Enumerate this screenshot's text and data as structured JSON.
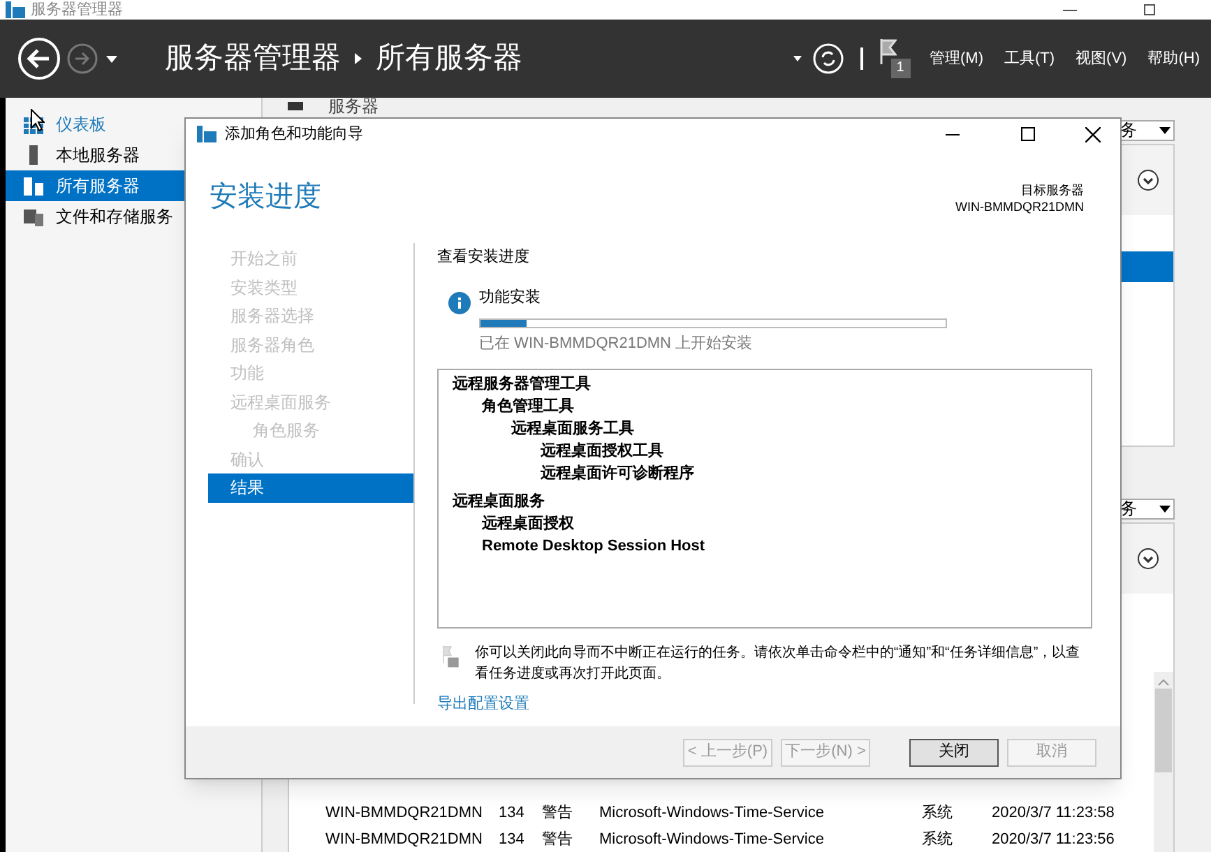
{
  "window": {
    "title": "服务器管理器"
  },
  "header": {
    "breadcrumb": [
      "服务器管理器",
      "所有服务器"
    ],
    "notification_count": "1",
    "menu": [
      "管理(M)",
      "工具(T)",
      "视图(V)",
      "帮助(H)"
    ]
  },
  "sidebar": {
    "items": [
      {
        "label": "仪表板",
        "selected": false,
        "kind": "dashboard"
      },
      {
        "label": "本地服务器",
        "selected": false,
        "kind": "server"
      },
      {
        "label": "所有服务器",
        "selected": true,
        "kind": "servers"
      },
      {
        "label": "文件和存储服务",
        "selected": false,
        "kind": "files"
      }
    ]
  },
  "main": {
    "section_title": "服务器",
    "panels": [
      {
        "dropdown": "务",
        "selected_row": true
      },
      {
        "dropdown": "务",
        "rows": [
          [
            "WIN-BMMDQR21DMN",
            "134",
            "警告",
            "Microsoft-Windows-Time-Service",
            "系统",
            "2020/3/7 11:23:58"
          ],
          [
            "WIN-BMMDQR21DMN",
            "134",
            "警告",
            "Microsoft-Windows-Time-Service",
            "系统",
            "2020/3/7 11:23:56"
          ]
        ]
      }
    ]
  },
  "dialog": {
    "title": "添加角色和功能向导",
    "heading": "安装进度",
    "target_label": "目标服务器",
    "target_server": "WIN-BMMDQR21DMN",
    "steps": [
      {
        "label": "开始之前",
        "selected": false
      },
      {
        "label": "安装类型",
        "selected": false
      },
      {
        "label": "服务器选择",
        "selected": false
      },
      {
        "label": "服务器角色",
        "selected": false
      },
      {
        "label": "功能",
        "selected": false
      },
      {
        "label": "远程桌面服务",
        "selected": false,
        "children": [
          {
            "label": "角色服务",
            "selected": false
          }
        ]
      },
      {
        "label": "确认",
        "selected": false
      },
      {
        "label": "结果",
        "selected": true
      }
    ],
    "section_title": "查看安装进度",
    "status_title": "功能安装",
    "progress": {
      "level": 0.1
    },
    "status_text": "已在 WIN-BMMDQR21DMN 上开始安装",
    "results": [
      {
        "label": "远程服务器管理工具",
        "children": [
          {
            "label": "角色管理工具",
            "children": [
              {
                "label": "远程桌面服务工具",
                "children": [
                  {
                    "label": "远程桌面授权工具"
                  },
                  {
                    "label": "远程桌面许可诊断程序"
                  }
                ]
              }
            ]
          }
        ]
      },
      {
        "label": "远程桌面服务",
        "children": [
          {
            "label": "远程桌面授权"
          },
          {
            "label": "Remote Desktop Session Host"
          }
        ]
      }
    ],
    "notice": "你可以关闭此向导而不中断正在运行的任务。请依次单击命令栏中的“通知”和“任务详细信息”，以查看任务进度或再次打开此页面。",
    "link": "导出配置设置",
    "buttons": [
      {
        "label": "< 上一步(P)",
        "disabled": true,
        "default": false
      },
      {
        "label": "下一步(N) >",
        "disabled": true,
        "default": false
      },
      {
        "label": "关闭",
        "disabled": false,
        "default": true
      },
      {
        "label": "取消",
        "disabled": true,
        "default": false
      }
    ]
  }
}
